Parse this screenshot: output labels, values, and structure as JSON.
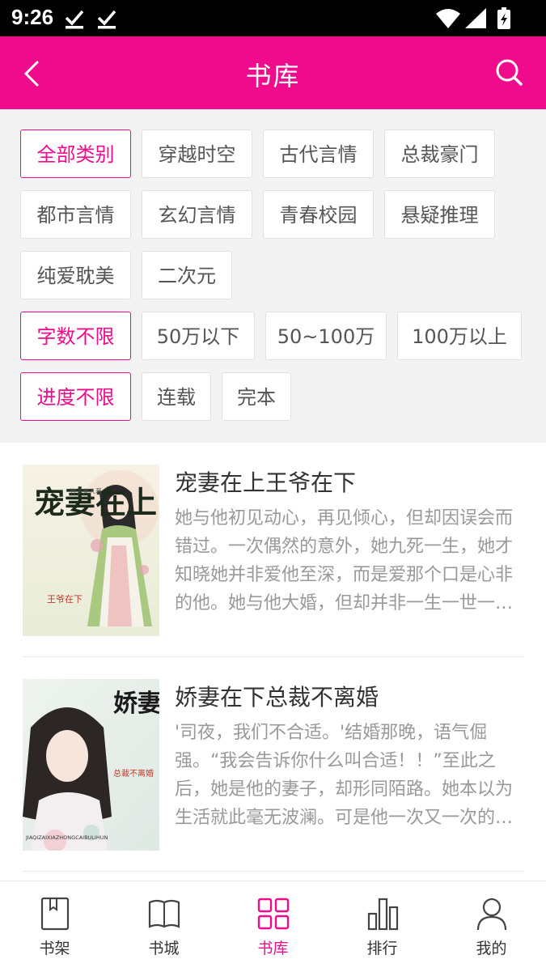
{
  "status_bar": {
    "time": "9:26",
    "icons": [
      "download-done-icon",
      "download-done-icon",
      "wifi-icon",
      "signal-icon",
      "battery-charging-icon"
    ]
  },
  "header": {
    "title": "书库",
    "back_icon": "chevron-left-icon",
    "search_icon": "search-icon",
    "background": "#f00b8c"
  },
  "filters": {
    "categories": [
      "全部类别",
      "穿越时空",
      "古代言情",
      "总裁豪门",
      "都市言情",
      "玄幻言情",
      "青春校园",
      "悬疑推理",
      "纯爱耽美",
      "二次元"
    ],
    "word_counts": [
      "字数不限",
      "50万以下",
      "50~100万",
      "100万以上"
    ],
    "progress": [
      "进度不限",
      "连载",
      "完本"
    ],
    "selected_color": "#f00b8c"
  },
  "books": [
    {
      "title": "宠妻在上王爷在下",
      "description": "她与他初见动心，再见倾心，但却因误会而错过。一次偶然的意外，她九死一生，她才知晓她并非爱他至深，而是爱那个口是心非的他。她与他大婚，但却并非一生一世一双人。",
      "cover_text": "宠妻在上",
      "cover_sub": "王爷在下",
      "cover_author": "竹子大人著"
    },
    {
      "title": "娇妻在下总裁不离婚",
      "description": "'司夜，我们不合适。'结婚那晚，语气倔强。“我会告诉你什么叫合适！！”至此之后，她是他的妻子，却形同陌路。她本以为生活就此毫无波澜。可是他一次又一次的出现。",
      "cover_text": "娇妻在下",
      "cover_sub": "总裁不离婚",
      "cover_pinyin": "JIAQIZAIXIAZHONGCAIBULIHUN"
    }
  ],
  "tabbar": {
    "tabs": [
      {
        "label": "书架",
        "icon": "bookshelf-icon"
      },
      {
        "label": "书城",
        "icon": "open-book-icon"
      },
      {
        "label": "书库",
        "icon": "grid-icon"
      },
      {
        "label": "排行",
        "icon": "bar-chart-icon"
      },
      {
        "label": "我的",
        "icon": "user-icon"
      }
    ],
    "active_index": 2
  }
}
